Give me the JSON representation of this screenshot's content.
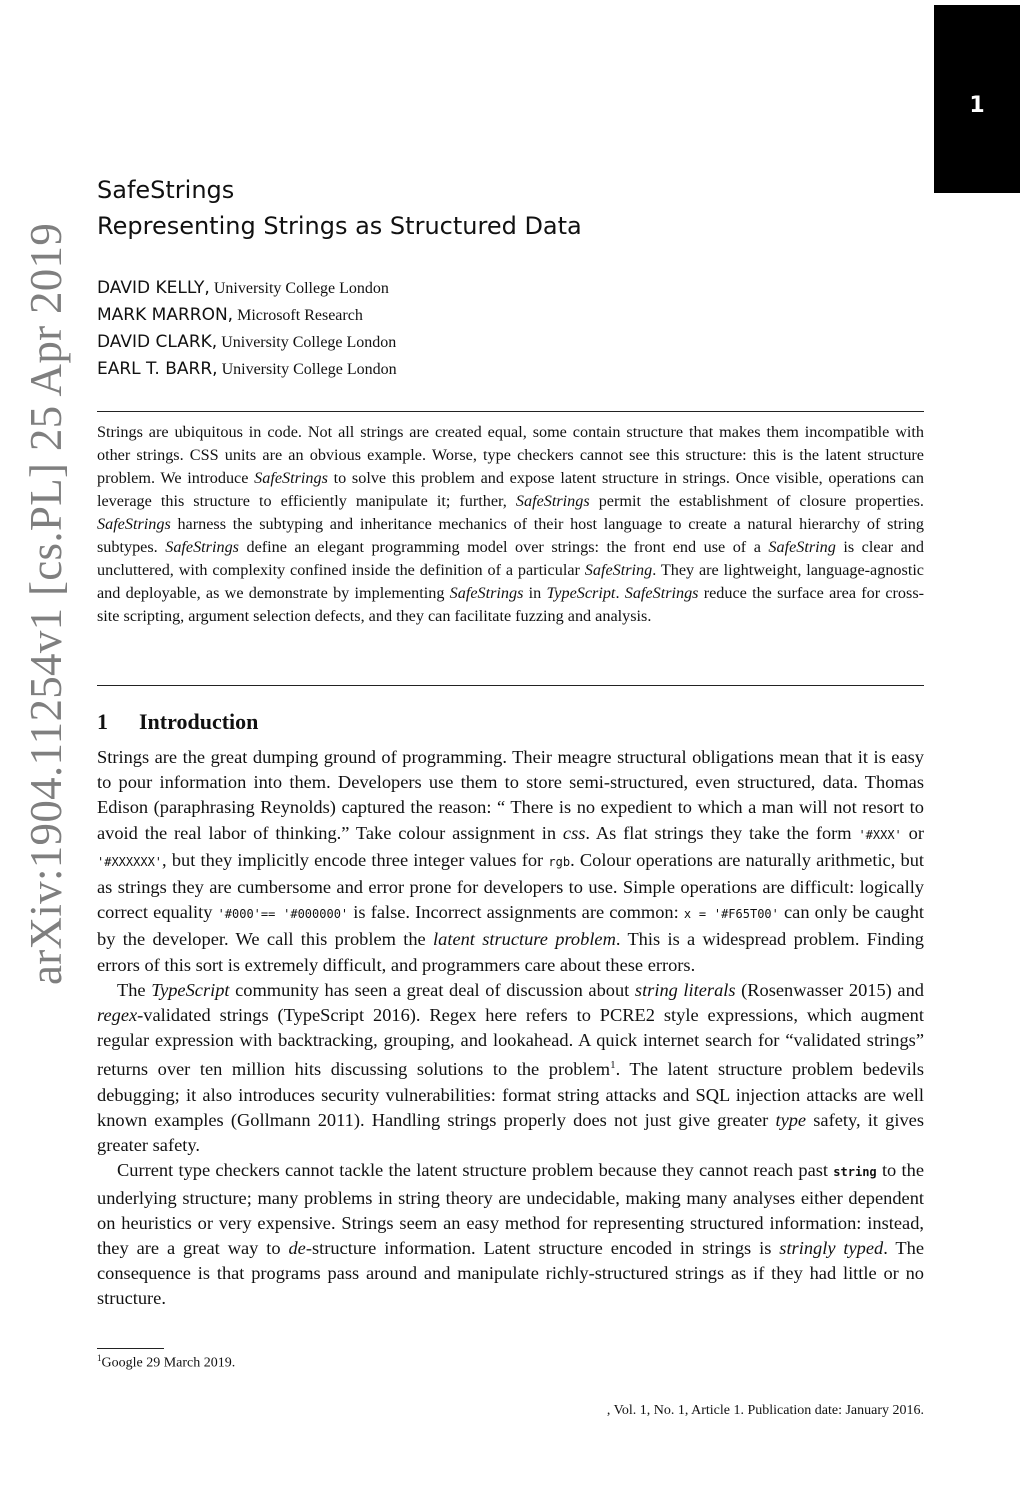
{
  "page_tab": {
    "number": "1"
  },
  "arxiv_stamp": "arXiv:1904.11254v1  [cs.PL]  25 Apr 2019",
  "title": {
    "line1": "SafeStrings",
    "line2": "Representing Strings as Structured Data"
  },
  "authors": [
    {
      "name": "DAVID KELLY,",
      "affiliation": "University College London"
    },
    {
      "name": "MARK MARRON,",
      "affiliation": "Microsoft Research"
    },
    {
      "name": "DAVID CLARK,",
      "affiliation": "University College London"
    },
    {
      "name": "EARL T. BARR,",
      "affiliation": "University College London"
    }
  ],
  "abstract": {
    "t1": "Strings are ubiquitous in code. Not all strings are created equal, some contain structure that makes them incompatible with other strings. CSS units are an obvious example. Worse, type checkers cannot see this structure: this is the latent structure problem. We introduce ",
    "i1": "SafeStrings",
    "t2": " to solve this problem and expose latent structure in strings. Once visible, operations can leverage this structure to efficiently manipulate it; further, ",
    "i2": "SafeStrings",
    "t3": " permit the establishment of closure properties. ",
    "i3": "SafeStrings",
    "t4": " harness the subtyping and inheritance mechanics of their host language to create a natural hierarchy of string subtypes. ",
    "i4": "SafeStrings",
    "t5": " define an elegant programming model over strings: the front end use of a ",
    "i5": "SafeString",
    "t6": " is clear and uncluttered, with complexity confined inside the definition of a particular ",
    "i6": "SafeString",
    "t7": ". They are lightweight, language-agnostic and deployable, as we demonstrate by implementing ",
    "i7": "SafeStrings",
    "t8": " in ",
    "i8": "TypeScript",
    "t9": ". ",
    "i9": "SafeStrings",
    "t10": " reduce the surface area for cross-site scripting, argument selection defects, and they can facilitate fuzzing and analysis."
  },
  "section": {
    "number": "1",
    "title": "Introduction"
  },
  "paragraphs": {
    "p1": {
      "t1": "Strings are the great dumping ground of programming. Their meagre structural obligations mean that it is easy to pour information into them. Developers use them to store semi-structured, even structured, data. Thomas Edison (paraphrasing Reynolds) captured the reason: “ There is no expedient to which a man will not resort to avoid the real labor of thinking.” Take colour assignment in ",
      "i1": "css",
      "t2": ". As flat strings they take the form ",
      "c1": "'#XXX'",
      "t3": " or ",
      "c2": "'#XXXXXX'",
      "t4": ", but they implicitly encode three integer values for ",
      "c3": "rgb",
      "t5": ". Colour operations are naturally arithmetic, but as strings they are cumbersome and error prone for developers to use. Simple operations are difficult: logically correct equality ",
      "c4": "'#000'== '#000000'",
      "t6": " is false. Incorrect assignments are common: ",
      "c5": "x = '#F65T00'",
      "t7": " can only be caught by the developer. We call this problem the ",
      "i2": "latent structure problem",
      "t8": ". This is a widespread problem. Finding errors of this sort is extremely difficult, and programmers care about these errors."
    },
    "p2": {
      "t1": "The ",
      "i1": "TypeScript",
      "t2": " community has seen a great deal of discussion about ",
      "i2": "string literals",
      "t3": " (Rosenwasser 2015) and ",
      "i3": "regex",
      "t4": "-validated strings (TypeScript 2016). Regex here refers to PCRE2 style expressions, which augment regular expression with backtracking, grouping, and lookahead. A quick internet search for “validated strings” returns over ten million hits discussing solutions to the problem",
      "fn": "1",
      "t5": ". The latent structure problem bedevils debugging; it also introduces security vulnerabilities: format string attacks and SQL injection attacks are well known examples (Gollmann 2011). Handling strings properly does not just give greater ",
      "i4": "type",
      "t6": " safety, it gives greater safety."
    },
    "p3": {
      "t1": "Current type checkers cannot tackle the latent structure problem because they cannot reach past ",
      "c1": "string",
      "t2": " to the underlying structure; many problems in string theory are undecidable, making many analyses either dependent on heuristics or very expensive. Strings seem an easy method for representing structured information: instead, they are a great way to ",
      "i1": "de",
      "t3": "-structure information. Latent structure encoded in strings is ",
      "i2": "stringly typed",
      "t4": ". The consequence is that programs pass around and manipulate richly-structured strings as if they had little or no structure."
    }
  },
  "footnote": {
    "mark": "1",
    "text": "Google 29 March 2019."
  },
  "running_footer": ", Vol. 1, No. 1, Article 1. Publication date: January 2016."
}
